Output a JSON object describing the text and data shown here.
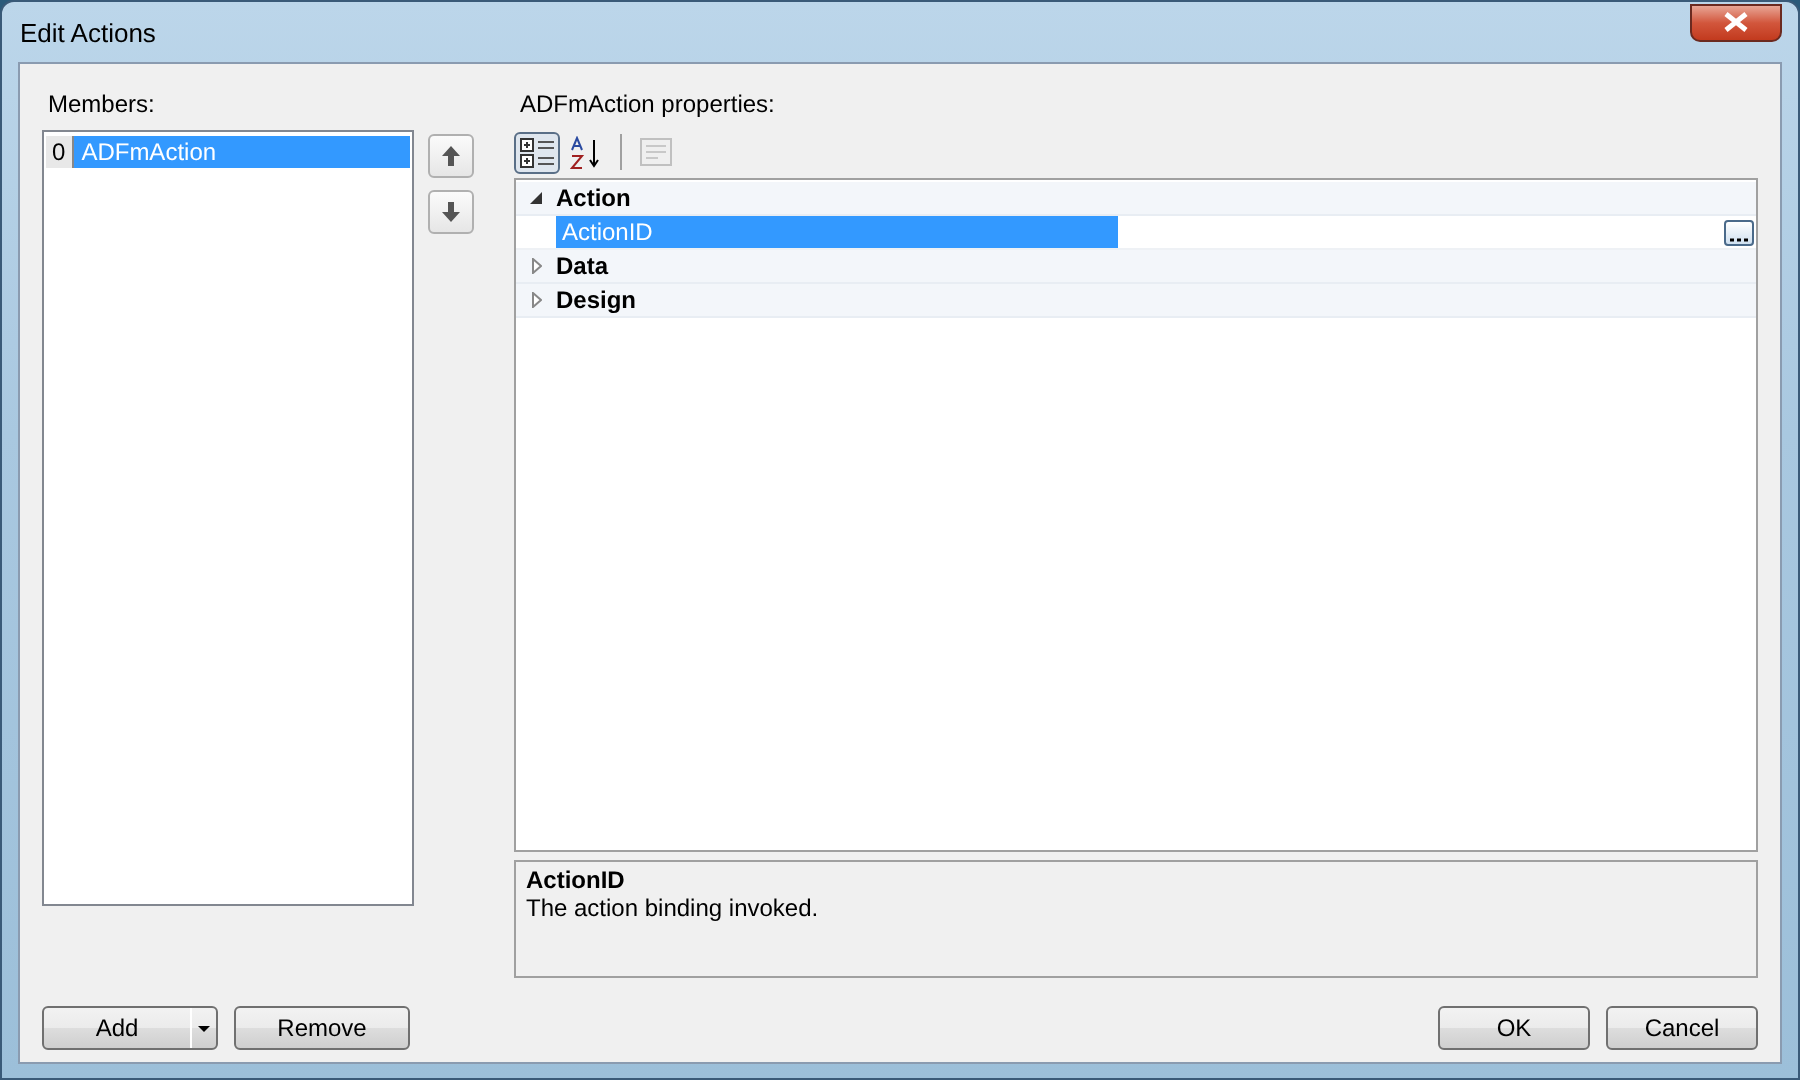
{
  "window": {
    "title": "Edit Actions"
  },
  "members": {
    "label": "Members:",
    "items": [
      {
        "index": "0",
        "name": "ADFmAction",
        "selected": true
      }
    ]
  },
  "move_buttons": [
    {
      "kind": "up",
      "disabled": false
    },
    {
      "kind": "down",
      "disabled": false
    }
  ],
  "properties": {
    "label": "ADFmAction properties:",
    "toolbar": [
      {
        "kind": "categorized",
        "selected": true,
        "disabled": false
      },
      {
        "kind": "alphabetical",
        "selected": false,
        "disabled": false
      },
      {
        "kind": "pages",
        "selected": false,
        "disabled": true
      }
    ],
    "categories": [
      {
        "name": "Action",
        "expanded": true,
        "properties": [
          {
            "name": "ActionID",
            "selected": true,
            "has_editor": true
          }
        ]
      },
      {
        "name": "Data",
        "expanded": false
      },
      {
        "name": "Design",
        "expanded": false
      }
    ],
    "description": {
      "title": "ActionID",
      "text": "The action binding invoked."
    }
  },
  "member_buttons": [
    {
      "label": "Add",
      "kind": "split"
    },
    {
      "label": "Remove",
      "kind": "plain"
    }
  ],
  "dialog_buttons": [
    "OK",
    "Cancel"
  ]
}
